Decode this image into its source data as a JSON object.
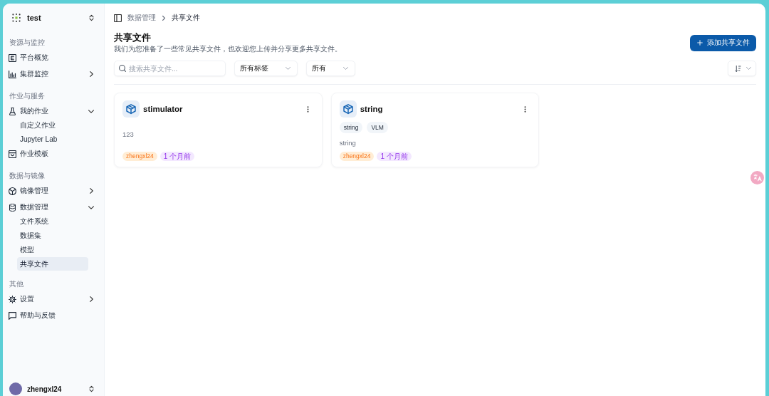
{
  "team": {
    "name": "test"
  },
  "sidebar": {
    "sections": [
      {
        "heading": "资源与监控",
        "items": [
          {
            "label": "平台概览",
            "kind": "link",
            "selected": false
          },
          {
            "label": "集群监控",
            "kind": "group",
            "expanded": false,
            "selected": false
          }
        ]
      },
      {
        "heading": "作业与服务",
        "items": [
          {
            "label": "我的作业",
            "kind": "group",
            "expanded": true,
            "selected": false,
            "children": [
              {
                "label": "自定义作业",
                "selected": false
              },
              {
                "label": "Jupyter Lab",
                "selected": false
              }
            ]
          },
          {
            "label": "作业模板",
            "kind": "link",
            "selected": false
          }
        ]
      },
      {
        "heading": "数据与镜像",
        "items": [
          {
            "label": "镜像管理",
            "kind": "group",
            "expanded": false,
            "selected": false
          },
          {
            "label": "数据管理",
            "kind": "group",
            "expanded": true,
            "selected": false,
            "children": [
              {
                "label": "文件系统",
                "selected": false
              },
              {
                "label": "数据集",
                "selected": false
              },
              {
                "label": "模型",
                "selected": false
              },
              {
                "label": "共享文件",
                "selected": true
              }
            ]
          }
        ]
      },
      {
        "heading": "其他",
        "items": [
          {
            "label": "设置",
            "kind": "group",
            "expanded": false,
            "selected": false
          },
          {
            "label": "帮助与反馈",
            "kind": "link",
            "selected": false
          }
        ]
      }
    ]
  },
  "user": {
    "name": "zhengxl24"
  },
  "breadcrumb": [
    {
      "label": "数据管理",
      "current": false
    },
    {
      "label": "共享文件",
      "current": true
    }
  ],
  "header": {
    "title": "共享文件",
    "subtitle": "我们为您准备了一些常见共享文件，也欢迎您上传并分享更多共享文件。",
    "add_button": "添加共享文件"
  },
  "filters": {
    "search": {
      "placeholder": "搜索共享文件..."
    },
    "tag_select": {
      "value": "所有标签"
    },
    "scope_select": {
      "value": "所有"
    }
  },
  "cards": [
    {
      "title": "stimulator",
      "description": "123",
      "owner": "zhengxl24",
      "time": "1 个月前"
    },
    {
      "title": "string",
      "tags": [
        "string",
        "VLM"
      ],
      "description": "string",
      "owner": "zhengxl24",
      "time": "1 个月前"
    }
  ]
}
